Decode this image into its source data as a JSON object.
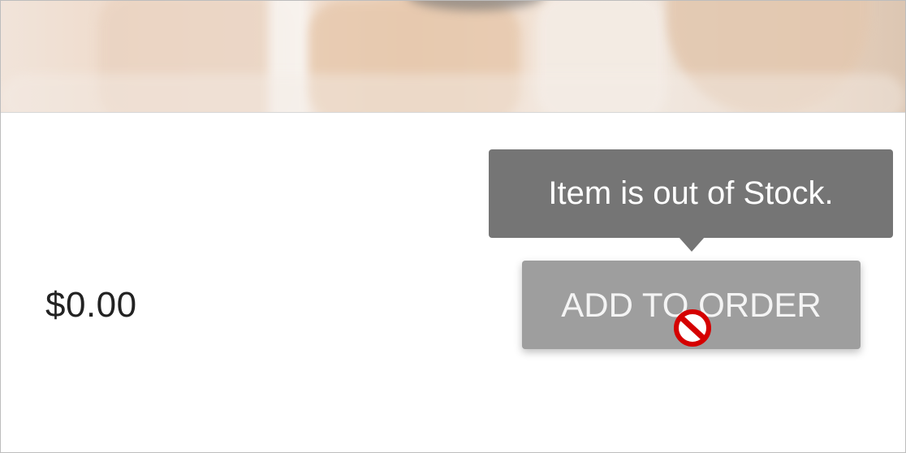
{
  "product": {
    "image_alt": "product-photo",
    "price": "$0.00"
  },
  "tooltip": {
    "text": "Item is out of Stock."
  },
  "actions": {
    "add_to_order_label": "ADD TO ORDER",
    "disabled": true
  },
  "cursor": {
    "type": "not-allowed-icon"
  },
  "colors": {
    "tooltip_bg": "#757575",
    "button_disabled_bg": "#9e9e9e",
    "price_text": "#222222",
    "cursor_red": "#d50000"
  }
}
